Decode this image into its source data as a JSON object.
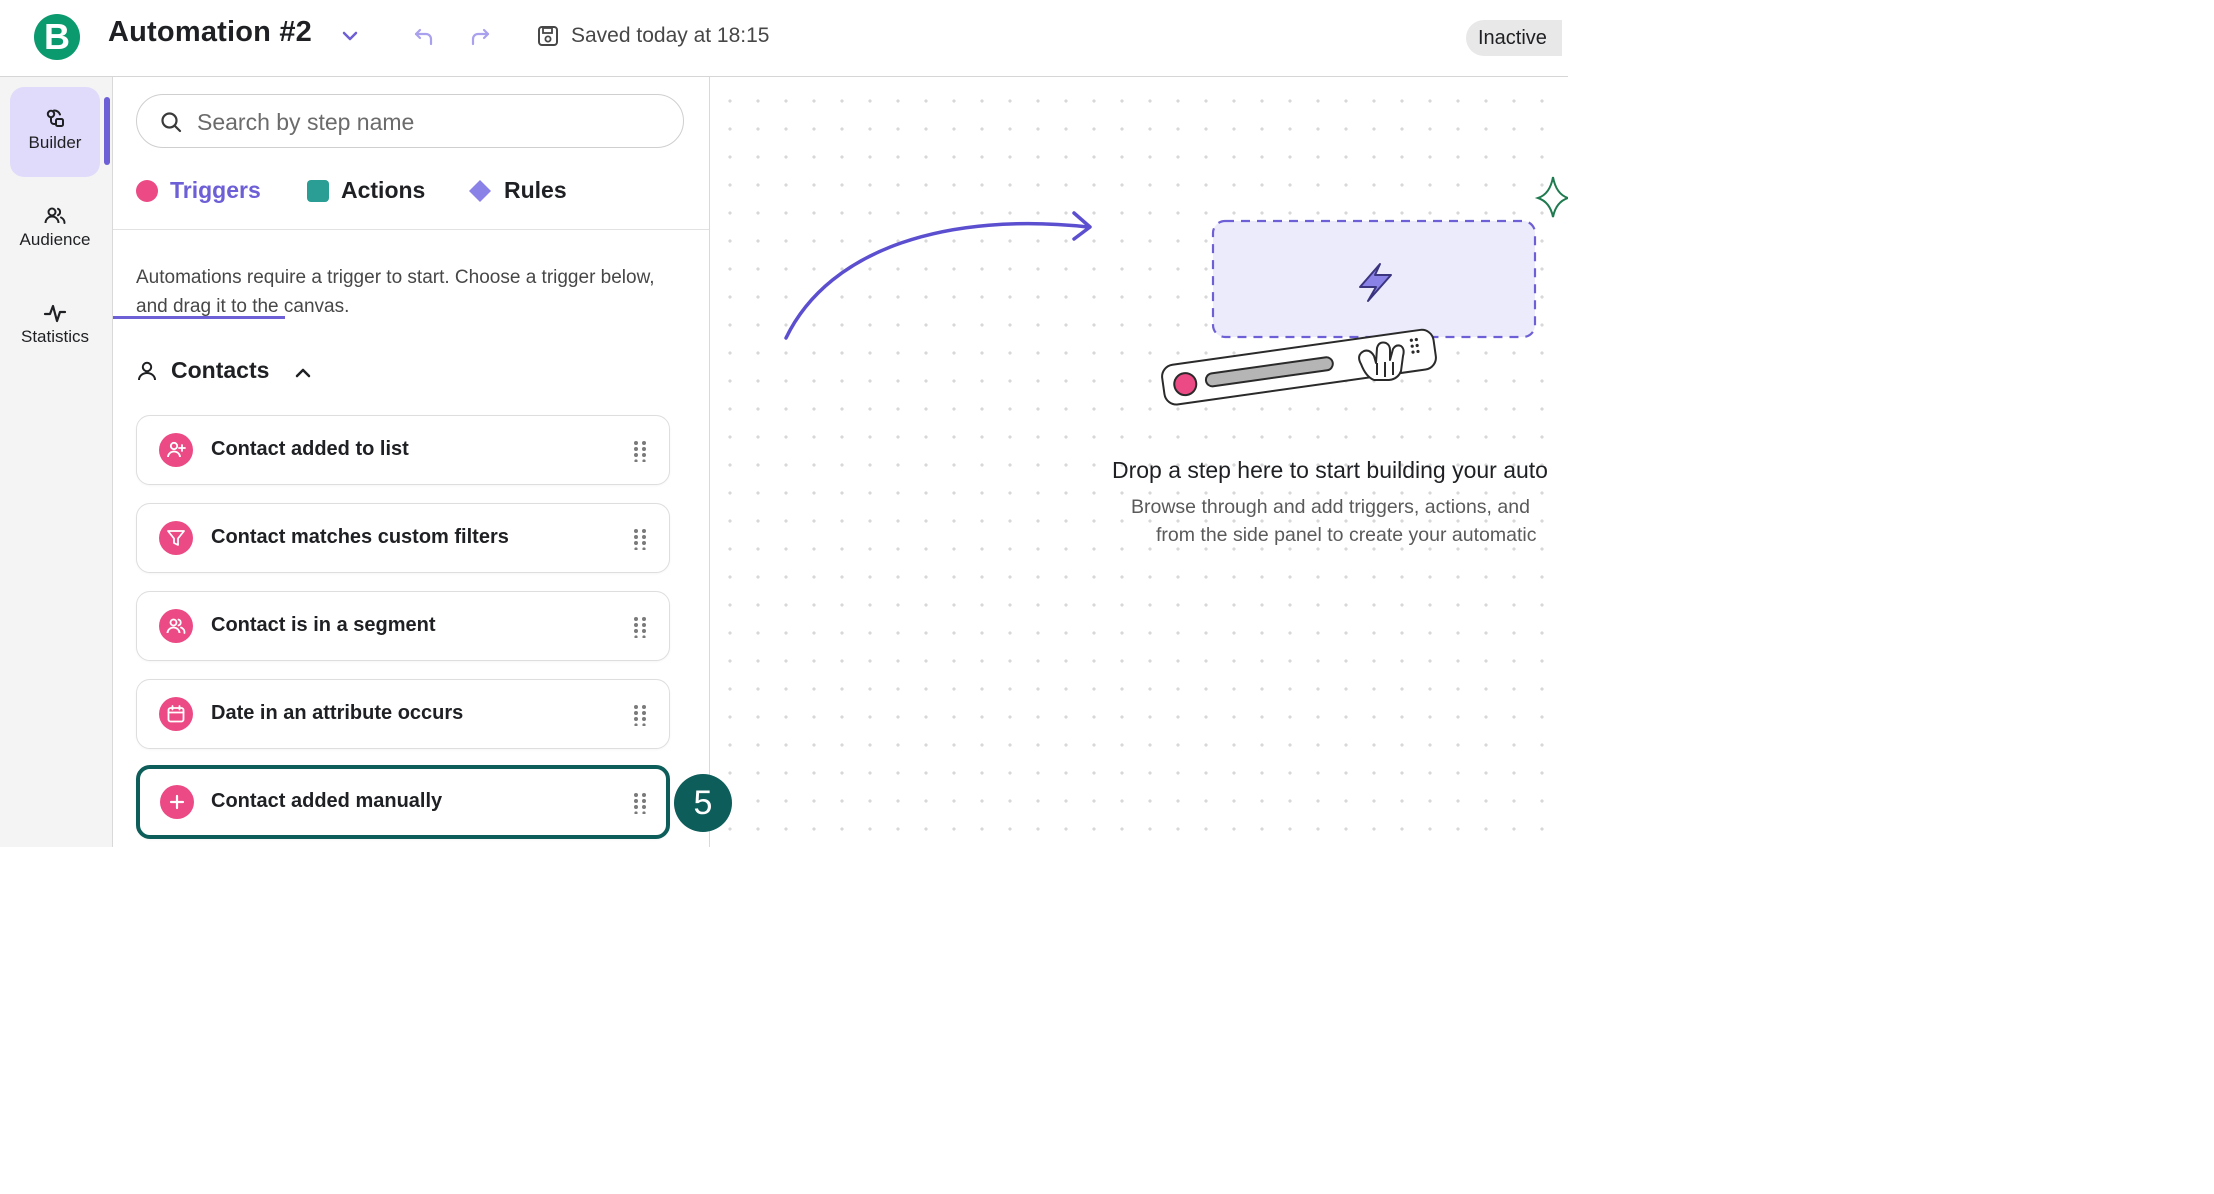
{
  "header": {
    "logo_letter": "B",
    "title": "Automation #2",
    "saved_status": "Saved today at 18:15",
    "status_badge": "Inactive"
  },
  "rail": {
    "items": [
      {
        "label": "Builder",
        "icon": "builder-icon",
        "active": true
      },
      {
        "label": "Audience",
        "icon": "audience-icon",
        "active": false
      },
      {
        "label": "Statistics",
        "icon": "statistics-icon",
        "active": false
      }
    ]
  },
  "panel": {
    "search": {
      "placeholder": "Search by step name",
      "value": ""
    },
    "tabs": [
      {
        "label": "Triggers",
        "color": "#ec4a85",
        "active": true
      },
      {
        "label": "Actions",
        "color": "#2a9d94",
        "active": false
      },
      {
        "label": "Rules",
        "color": "#8b82e8",
        "active": false
      }
    ],
    "intro": "Automations require a trigger to start. Choose a trigger below, and drag it to the canvas.",
    "section": {
      "title": "Contacts",
      "expanded": true
    },
    "triggers": [
      {
        "label": "Contact added to list",
        "icon": "user-plus-icon"
      },
      {
        "label": "Contact matches custom filters",
        "icon": "filter-icon"
      },
      {
        "label": "Contact is in a segment",
        "icon": "users-icon"
      },
      {
        "label": "Date in an attribute occurs",
        "icon": "calendar-icon"
      },
      {
        "label": "Contact added manually",
        "icon": "plus-icon",
        "highlighted": true
      }
    ]
  },
  "step_badge": "5",
  "canvas": {
    "drop_title": "Drop a step here to start building your auto",
    "drop_sub1": "Browse through and add triggers, actions, and",
    "drop_sub2": "from the side panel to create your automatic"
  },
  "colors": {
    "brand": "#0b996e",
    "accent": "#6d5fd6",
    "trigger_pink": "#ec4a85",
    "highlight": "#0d5d5a"
  }
}
